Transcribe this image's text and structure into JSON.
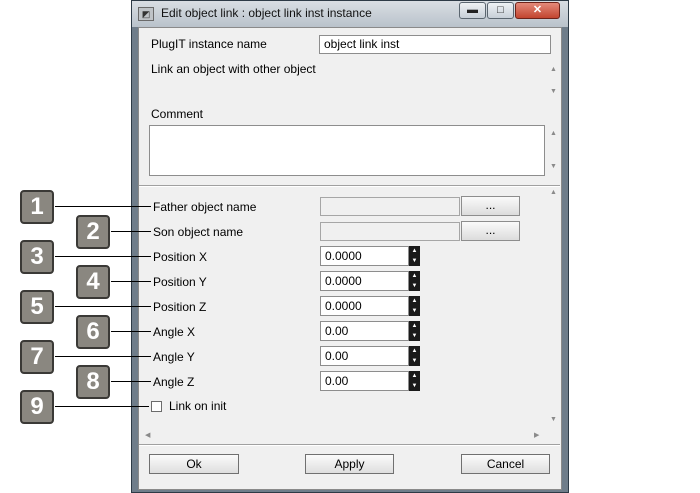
{
  "window": {
    "title": "Edit object link : object link inst instance",
    "minimize_glyph": "▬",
    "maximize_glyph": "□",
    "close_glyph": "✕",
    "app_icon": "app-icon"
  },
  "header": {
    "instance_name_label": "PlugIT instance name",
    "instance_name_value": "object link inst",
    "description": "Link an object with other object",
    "comment_label": "Comment",
    "comment_value": ""
  },
  "params": {
    "father_label": "Father object name",
    "father_value": "",
    "father_browse": "...",
    "son_label": "Son object name",
    "son_value": "",
    "son_browse": "...",
    "pos_x_label": "Position X",
    "pos_x_value": "0.0000",
    "pos_y_label": "Position Y",
    "pos_y_value": "0.0000",
    "pos_z_label": "Position Z",
    "pos_z_value": "0.0000",
    "angle_x_label": "Angle X",
    "angle_x_value": "0.00",
    "angle_y_label": "Angle Y",
    "angle_y_value": "0.00",
    "angle_z_label": "Angle Z",
    "angle_z_value": "0.00",
    "link_on_init_label": "Link on init",
    "link_on_init_checked": false
  },
  "buttons": {
    "ok": "Ok",
    "apply": "Apply",
    "cancel": "Cancel"
  },
  "callouts": [
    "1",
    "2",
    "3",
    "4",
    "5",
    "6",
    "7",
    "8",
    "9"
  ],
  "colors": {
    "badge": "#8a8780",
    "titlebar": "#c9d1d9",
    "dialog_bg": "#f0f0f0"
  }
}
